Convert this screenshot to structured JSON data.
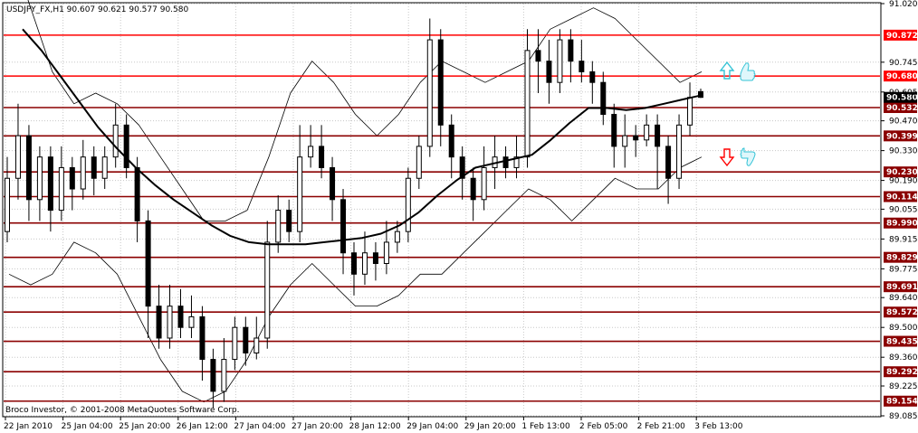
{
  "chart_data": {
    "type": "candlestick",
    "title": "USDJPY_FX,H1  90.607 90.621 90.577 90.580",
    "symbol": "USDJPY_FX,H1",
    "ohlc": {
      "open": 90.607,
      "high": 90.621,
      "low": 90.577,
      "close": 90.58
    },
    "ylim": [
      89.085,
      91.02
    ],
    "y_ticks": [
      "91.020",
      "90.745",
      "90.605",
      "90.470",
      "90.330",
      "90.190",
      "90.055",
      "89.915",
      "89.775",
      "89.640",
      "89.500",
      "89.360",
      "89.225",
      "89.085"
    ],
    "x_ticks": [
      "22 Jan 2010",
      "25 Jan 04:00",
      "25 Jan 20:00",
      "26 Jan 12:00",
      "27 Jan 04:00",
      "27 Jan 20:00",
      "28 Jan 12:00",
      "29 Jan 04:00",
      "29 Jan 20:00",
      "1 Feb 13:00",
      "2 Feb 05:00",
      "2 Feb 21:00",
      "3 Feb 13:00"
    ],
    "levels": [
      {
        "value": 90.872,
        "label": "90.872",
        "color": "#ff0000"
      },
      {
        "value": 90.68,
        "label": "90.680",
        "color": "#ff0000"
      },
      {
        "value": 90.532,
        "label": "90.532",
        "color": "#8b0000"
      },
      {
        "value": 90.399,
        "label": "90.399",
        "color": "#8b0000"
      },
      {
        "value": 90.23,
        "label": "90.230",
        "color": "#8b0000"
      },
      {
        "value": 90.114,
        "label": "90.114",
        "color": "#8b0000"
      },
      {
        "value": 89.99,
        "label": "89.990",
        "color": "#8b0000"
      },
      {
        "value": 89.829,
        "label": "89.829",
        "color": "#8b0000"
      },
      {
        "value": 89.691,
        "label": "89.691",
        "color": "#8b0000"
      },
      {
        "value": 89.572,
        "label": "89.572",
        "color": "#8b0000"
      },
      {
        "value": 89.435,
        "label": "89.435",
        "color": "#8b0000"
      },
      {
        "value": 89.292,
        "label": "89.292",
        "color": "#8b0000"
      },
      {
        "value": 89.154,
        "label": "89.154",
        "color": "#8b0000"
      }
    ],
    "current_price": {
      "value": 90.58,
      "label": "90.580"
    },
    "moving_average": [
      90.9,
      90.8,
      90.68,
      90.56,
      90.44,
      90.34,
      90.25,
      90.17,
      90.1,
      90.04,
      89.98,
      89.93,
      89.9,
      89.89,
      89.89,
      89.89,
      89.9,
      89.91,
      89.92,
      89.94,
      89.98,
      90.04,
      90.12,
      90.19,
      90.25,
      90.27,
      90.29,
      90.31,
      90.38,
      90.46,
      90.53,
      90.53,
      90.52,
      90.53,
      90.55,
      90.57,
      90.59
    ],
    "upper_band": [
      91.3,
      91.0,
      90.7,
      90.55,
      90.6,
      90.55,
      90.45,
      90.3,
      90.15,
      90.0,
      90.0,
      90.05,
      90.3,
      90.6,
      90.75,
      90.65,
      90.5,
      90.4,
      90.5,
      90.65,
      90.75,
      90.7,
      90.65,
      90.7,
      90.75,
      90.9,
      90.95,
      91.0,
      90.95,
      90.85,
      90.75,
      90.65,
      90.7
    ],
    "lower_band": [
      89.75,
      89.7,
      89.75,
      89.9,
      89.85,
      89.75,
      89.55,
      89.35,
      89.2,
      89.15,
      89.2,
      89.35,
      89.55,
      89.7,
      89.8,
      89.7,
      89.6,
      89.6,
      89.65,
      89.75,
      89.75,
      89.85,
      89.95,
      90.05,
      90.15,
      90.1,
      90.0,
      90.1,
      90.2,
      90.15,
      90.15,
      90.25,
      90.3
    ],
    "candles": [
      [
        89.95,
        90.2,
        90.3,
        89.9
      ],
      [
        90.2,
        90.4,
        90.55,
        90.1
      ],
      [
        90.4,
        90.1,
        90.45,
        90.0
      ],
      [
        90.1,
        90.3,
        90.35,
        90.0
      ],
      [
        90.3,
        90.05,
        90.35,
        89.95
      ],
      [
        90.05,
        90.25,
        90.35,
        90.0
      ],
      [
        90.25,
        90.15,
        90.3,
        90.05
      ],
      [
        90.15,
        90.3,
        90.38,
        90.1
      ],
      [
        90.3,
        90.2,
        90.35,
        90.12
      ],
      [
        90.2,
        90.3,
        90.35,
        90.15
      ],
      [
        90.3,
        90.45,
        90.55,
        90.25
      ],
      [
        90.45,
        90.25,
        90.5,
        90.2
      ],
      [
        90.25,
        90.0,
        90.3,
        89.9
      ],
      [
        90.0,
        89.6,
        90.05,
        89.45
      ],
      [
        89.6,
        89.45,
        89.7,
        89.4
      ],
      [
        89.45,
        89.6,
        89.7,
        89.4
      ],
      [
        89.6,
        89.5,
        89.68,
        89.45
      ],
      [
        89.5,
        89.55,
        89.65,
        89.45
      ],
      [
        89.55,
        89.35,
        89.6,
        89.25
      ],
      [
        89.35,
        89.2,
        89.4,
        89.12
      ],
      [
        89.2,
        89.35,
        89.45,
        89.15
      ],
      [
        89.35,
        89.5,
        89.55,
        89.3
      ],
      [
        89.5,
        89.38,
        89.55,
        89.32
      ],
      [
        89.38,
        89.45,
        89.55,
        89.35
      ],
      [
        89.45,
        89.9,
        90.0,
        89.4
      ],
      [
        89.9,
        90.05,
        90.12,
        89.85
      ],
      [
        90.05,
        89.95,
        90.1,
        89.9
      ],
      [
        89.95,
        90.3,
        90.45,
        89.9
      ],
      [
        90.3,
        90.35,
        90.45,
        90.25
      ],
      [
        90.35,
        90.25,
        90.45,
        90.2
      ],
      [
        90.25,
        90.1,
        90.3,
        90.0
      ],
      [
        90.1,
        89.85,
        90.15,
        89.75
      ],
      [
        89.85,
        89.75,
        89.9,
        89.65
      ],
      [
        89.75,
        89.85,
        89.95,
        89.7
      ],
      [
        89.85,
        89.8,
        89.9,
        89.72
      ],
      [
        89.8,
        89.9,
        90.0,
        89.75
      ],
      [
        89.9,
        89.95,
        90.0,
        89.85
      ],
      [
        89.95,
        90.2,
        90.25,
        89.9
      ],
      [
        90.2,
        90.35,
        90.4,
        90.15
      ],
      [
        90.35,
        90.85,
        90.95,
        90.3
      ],
      [
        90.85,
        90.45,
        90.9,
        90.35
      ],
      [
        90.45,
        90.3,
        90.5,
        90.2
      ],
      [
        90.3,
        90.2,
        90.35,
        90.1
      ],
      [
        90.2,
        90.1,
        90.25,
        90.0
      ],
      [
        90.1,
        90.25,
        90.35,
        90.05
      ],
      [
        90.25,
        90.3,
        90.4,
        90.15
      ],
      [
        90.3,
        90.25,
        90.35,
        90.2
      ],
      [
        90.25,
        90.3,
        90.4,
        90.2
      ],
      [
        90.3,
        90.8,
        90.9,
        90.25
      ],
      [
        90.8,
        90.75,
        90.9,
        90.6
      ],
      [
        90.75,
        90.65,
        90.85,
        90.55
      ],
      [
        90.65,
        90.85,
        90.9,
        90.6
      ],
      [
        90.85,
        90.75,
        90.9,
        90.65
      ],
      [
        90.75,
        90.7,
        90.85,
        90.65
      ],
      [
        90.7,
        90.65,
        90.75,
        90.55
      ],
      [
        90.65,
        90.5,
        90.7,
        90.45
      ],
      [
        90.5,
        90.35,
        90.55,
        90.25
      ],
      [
        90.35,
        90.4,
        90.5,
        90.25
      ],
      [
        90.4,
        90.38,
        90.45,
        90.3
      ],
      [
        90.38,
        90.45,
        90.5,
        90.35
      ],
      [
        90.45,
        90.35,
        90.5,
        90.15
      ],
      [
        90.35,
        90.2,
        90.4,
        90.08
      ],
      [
        90.2,
        90.45,
        90.5,
        90.15
      ],
      [
        90.45,
        90.58,
        90.65,
        90.4
      ],
      [
        90.607,
        90.58,
        90.621,
        90.577
      ]
    ]
  },
  "labels": {
    "copyright": "Broco Investor, © 2001-2008 MetaQuotes Software Corp."
  },
  "colors": {
    "background": "#ffffff",
    "grid": "#b8b8b8",
    "candle": "#000000",
    "level_red": "#ff0000",
    "level_dark": "#8b0000",
    "buy_arrow": "#33c3d6",
    "sell_arrow": "#ff0000"
  },
  "icons": {
    "buy_signal": "up-arrow-icon",
    "buy_thumb": "thumbs-up-icon",
    "sell_signal": "down-arrow-icon",
    "sell_thumb": "thumbs-down-icon"
  }
}
